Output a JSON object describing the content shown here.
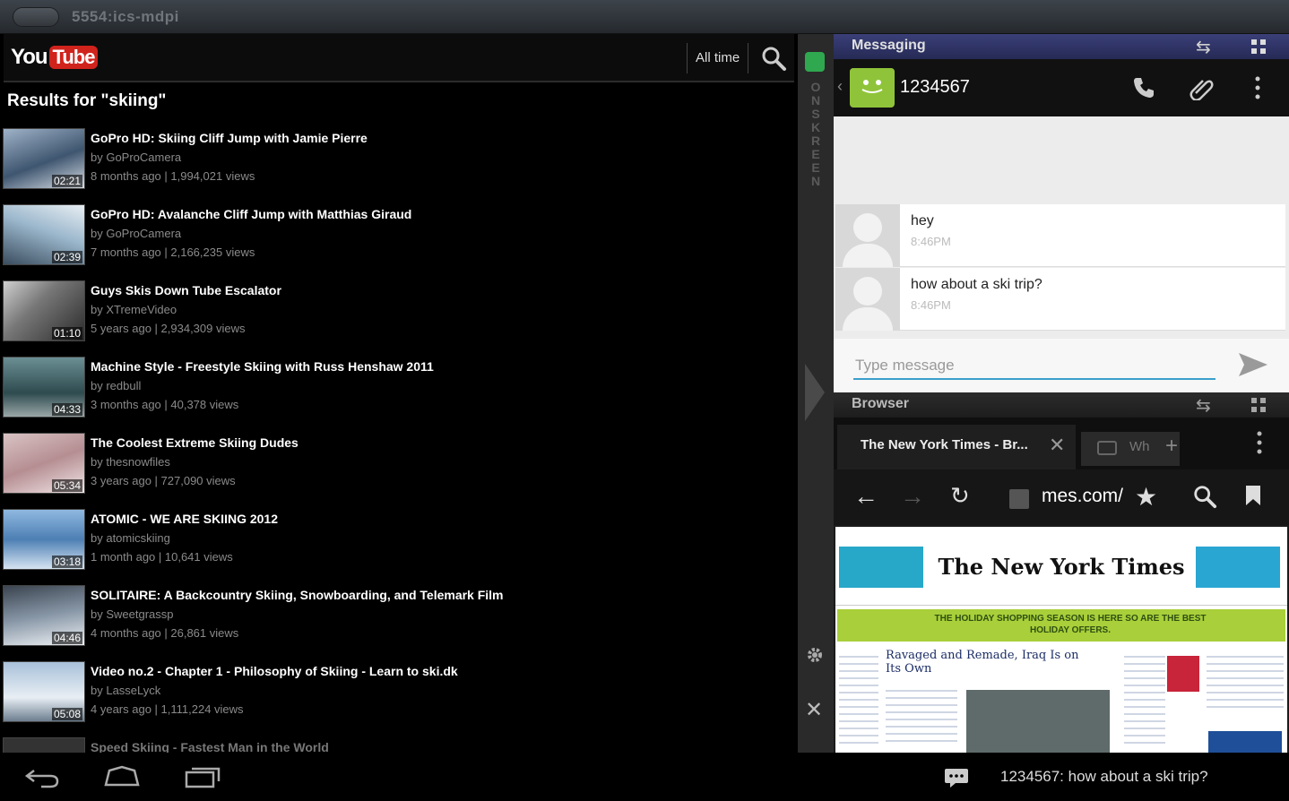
{
  "window": {
    "title": "5554:ics-mdpi"
  },
  "youtube": {
    "logo_you": "You",
    "logo_tube": "Tube",
    "filter_label": "All time",
    "results_heading": "Results for \"skiing\"",
    "videos": [
      {
        "title": "GoPro HD: Skiing Cliff Jump with Jamie Pierre",
        "author": "by GoProCamera",
        "meta": "8 months ago | 1,994,021 views",
        "duration": "02:21"
      },
      {
        "title": "GoPro HD: Avalanche Cliff Jump with Matthias Giraud",
        "author": "by GoProCamera",
        "meta": "7 months ago | 2,166,235 views",
        "duration": "02:39"
      },
      {
        "title": "Guys Skis Down Tube Escalator",
        "author": "by XTremeVideo",
        "meta": "5 years ago | 2,934,309 views",
        "duration": "01:10"
      },
      {
        "title": "Machine Style - Freestyle Skiing with Russ Henshaw 2011",
        "author": "by redbull",
        "meta": "3 months ago | 40,378 views",
        "duration": "04:33"
      },
      {
        "title": "The Coolest Extreme Skiing Dudes",
        "author": "by thesnowfiles",
        "meta": "3 years ago | 727,090 views",
        "duration": "05:34"
      },
      {
        "title": "ATOMIC - WE ARE SKIING 2012",
        "author": "by atomicskiing",
        "meta": "1 month ago | 10,641 views",
        "duration": "03:18"
      },
      {
        "title": "SOLITAIRE: A Backcountry Skiing, Snowboarding, and Telemark Film",
        "author": "by Sweetgrassp",
        "meta": "4 months ago | 26,861 views",
        "duration": "04:46"
      },
      {
        "title": "Video no.2 - Chapter 1 - Philosophy of Skiing - Learn to ski.dk",
        "author": "by LasseLyck",
        "meta": "4 years ago | 1,111,224 views",
        "duration": "05:08"
      },
      {
        "title": "Speed Skiing - Fastest Man in the World",
        "author": "",
        "meta": "",
        "duration": ""
      }
    ]
  },
  "onskreen": {
    "vertical_label": "ONSKREEN"
  },
  "messaging": {
    "panel_title": "Messaging",
    "contact_number": "1234567",
    "messages": [
      {
        "text": "hey",
        "time": "8:46PM"
      },
      {
        "text": "how about a ski trip?",
        "time": "8:46PM"
      }
    ],
    "compose_placeholder": "Type message"
  },
  "browser": {
    "panel_title": "Browser",
    "active_tab_title": "The New York Times - Br...",
    "second_tab_title": "Wh",
    "url": "mes.com/",
    "page": {
      "masthead": "The New York Times",
      "banner_text": "THE HOLIDAY SHOPPING SEASON IS HERE SO ARE THE BEST HOLIDAY OFFERS.",
      "headline": "Ravaged and Remade, Iraq Is on Its Own"
    }
  },
  "statusbar": {
    "notification_text": "1234567: how about a ski trip?"
  },
  "colors": {
    "youtube_red": "#d0231c",
    "messaging_header": "#2e3266",
    "compose_underline": "#3b9fcb",
    "avatar_green": "#8fc43a"
  }
}
